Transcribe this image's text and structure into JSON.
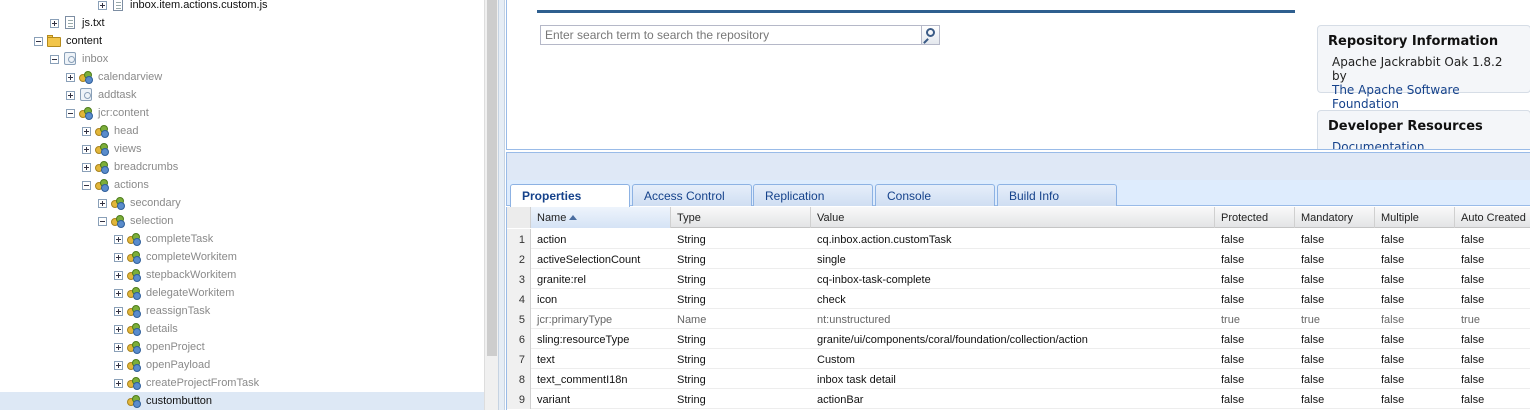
{
  "tree": {
    "nodes": [
      {
        "label": "inbox.item.actions.custom.js",
        "toggle": "plus",
        "icon": "file",
        "level": 4,
        "style": "dark"
      },
      {
        "label": "js.txt",
        "toggle": "plus",
        "icon": "file",
        "level": 1,
        "style": "dark"
      },
      {
        "label": "content",
        "toggle": "minus",
        "icon": "folder",
        "level": 0,
        "style": "dark"
      },
      {
        "label": "inbox",
        "toggle": "minus",
        "icon": "page",
        "level": 1,
        "style": "dim"
      },
      {
        "label": "calendarview",
        "toggle": "plus",
        "icon": "node",
        "level": 2,
        "style": "dim"
      },
      {
        "label": "addtask",
        "toggle": "plus",
        "icon": "page",
        "level": 2,
        "style": "dim"
      },
      {
        "label": "jcr:content",
        "toggle": "minus",
        "icon": "node",
        "level": 2,
        "style": "dim"
      },
      {
        "label": "head",
        "toggle": "plus",
        "icon": "node",
        "level": 3,
        "style": "dim"
      },
      {
        "label": "views",
        "toggle": "plus",
        "icon": "node",
        "level": 3,
        "style": "dim"
      },
      {
        "label": "breadcrumbs",
        "toggle": "plus",
        "icon": "node",
        "level": 3,
        "style": "dim"
      },
      {
        "label": "actions",
        "toggle": "minus",
        "icon": "node",
        "level": 3,
        "style": "dim"
      },
      {
        "label": "secondary",
        "toggle": "plus",
        "icon": "node",
        "level": 4,
        "style": "dim"
      },
      {
        "label": "selection",
        "toggle": "minus",
        "icon": "node",
        "level": 4,
        "style": "dim"
      },
      {
        "label": "completeTask",
        "toggle": "plus",
        "icon": "node",
        "level": 5,
        "style": "dim"
      },
      {
        "label": "completeWorkitem",
        "toggle": "plus",
        "icon": "node",
        "level": 5,
        "style": "dim"
      },
      {
        "label": "stepbackWorkitem",
        "toggle": "plus",
        "icon": "node",
        "level": 5,
        "style": "dim"
      },
      {
        "label": "delegateWorkitem",
        "toggle": "plus",
        "icon": "node",
        "level": 5,
        "style": "dim"
      },
      {
        "label": "reassignTask",
        "toggle": "plus",
        "icon": "node",
        "level": 5,
        "style": "dim"
      },
      {
        "label": "details",
        "toggle": "plus",
        "icon": "node",
        "level": 5,
        "style": "dim"
      },
      {
        "label": "openProject",
        "toggle": "plus",
        "icon": "node",
        "level": 5,
        "style": "dim"
      },
      {
        "label": "openPayload",
        "toggle": "plus",
        "icon": "node",
        "level": 5,
        "style": "dim"
      },
      {
        "label": "createProjectFromTask",
        "toggle": "plus",
        "icon": "node",
        "level": 5,
        "style": "dim"
      },
      {
        "label": "custombutton",
        "toggle": "none",
        "icon": "node",
        "level": 5,
        "style": "dark",
        "selected": true
      }
    ]
  },
  "search": {
    "placeholder": "Enter search term to search the repository",
    "icon": "search-icon"
  },
  "repository_info": {
    "title": "Repository Information",
    "product": "Apache Jackrabbit Oak 1.8.2 by",
    "vendor_link": "The Apache Software Foundation"
  },
  "developer_resources": {
    "title": "Developer Resources",
    "first_link": "Documentation"
  },
  "tabs": [
    "Properties",
    "Access Control",
    "Replication",
    "Console",
    "Build Info"
  ],
  "grid": {
    "columns": [
      "",
      "Name",
      "Type",
      "Value",
      "Protected",
      "Mandatory",
      "Multiple",
      "Auto Created"
    ],
    "sorted_column": "Name",
    "rows": [
      {
        "num": "1",
        "name": "action",
        "type": "String",
        "value": "cq.inbox.action.customTask",
        "protected": "false",
        "mandatory": "false",
        "multiple": "false",
        "auto": "false"
      },
      {
        "num": "2",
        "name": "activeSelectionCount",
        "type": "String",
        "value": "single",
        "protected": "false",
        "mandatory": "false",
        "multiple": "false",
        "auto": "false"
      },
      {
        "num": "3",
        "name": "granite:rel",
        "type": "String",
        "value": "cq-inbox-task-complete",
        "protected": "false",
        "mandatory": "false",
        "multiple": "false",
        "auto": "false"
      },
      {
        "num": "4",
        "name": "icon",
        "type": "String",
        "value": "check",
        "protected": "false",
        "mandatory": "false",
        "multiple": "false",
        "auto": "false"
      },
      {
        "num": "5",
        "name": "jcr:primaryType",
        "type": "Name",
        "value": "nt:unstructured",
        "protected": "true",
        "mandatory": "true",
        "multiple": "false",
        "auto": "true",
        "dim": true
      },
      {
        "num": "6",
        "name": "sling:resourceType",
        "type": "String",
        "value": "granite/ui/components/coral/foundation/collection/action",
        "protected": "false",
        "mandatory": "false",
        "multiple": "false",
        "auto": "false"
      },
      {
        "num": "7",
        "name": "text",
        "type": "String",
        "value": "Custom",
        "protected": "false",
        "mandatory": "false",
        "multiple": "false",
        "auto": "false"
      },
      {
        "num": "8",
        "name": "text_commentI18n",
        "type": "String",
        "value": "inbox task detail",
        "protected": "false",
        "mandatory": "false",
        "multiple": "false",
        "auto": "false"
      },
      {
        "num": "9",
        "name": "variant",
        "type": "String",
        "value": "actionBar",
        "protected": "false",
        "mandatory": "false",
        "multiple": "false",
        "auto": "false"
      }
    ]
  }
}
